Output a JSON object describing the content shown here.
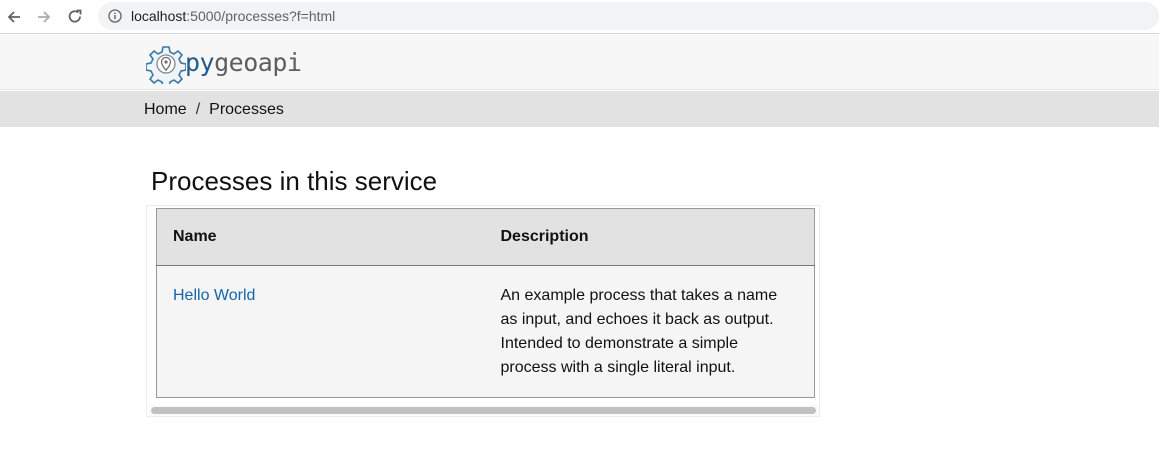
{
  "browser": {
    "url_host": "localhost",
    "url_rest": ":5000/processes?f=html",
    "icons": {
      "back": "arrow-left-icon",
      "forward": "arrow-right-icon",
      "reload": "reload-icon",
      "info": "info-icon"
    }
  },
  "header": {
    "logo_py": "py",
    "logo_geoapi": "geoapi",
    "colors": {
      "py": "#1f5a8c",
      "geoapi": "#5e5e5e"
    }
  },
  "breadcrumb": {
    "items": [
      {
        "label": "Home"
      },
      {
        "label": "Processes"
      }
    ],
    "separator": "/"
  },
  "main": {
    "title": "Processes in this service",
    "table": {
      "columns": [
        "Name",
        "Description"
      ],
      "rows": [
        {
          "name": "Hello World",
          "description": "An example process that takes a name as input, and echoes it back as output. Intended to demonstrate a simple process with a single literal input."
        }
      ]
    }
  },
  "colors": {
    "link": "#1465a8",
    "breadcrumb_bg": "#e2e2e2",
    "header_bg": "#f7f7f7"
  }
}
